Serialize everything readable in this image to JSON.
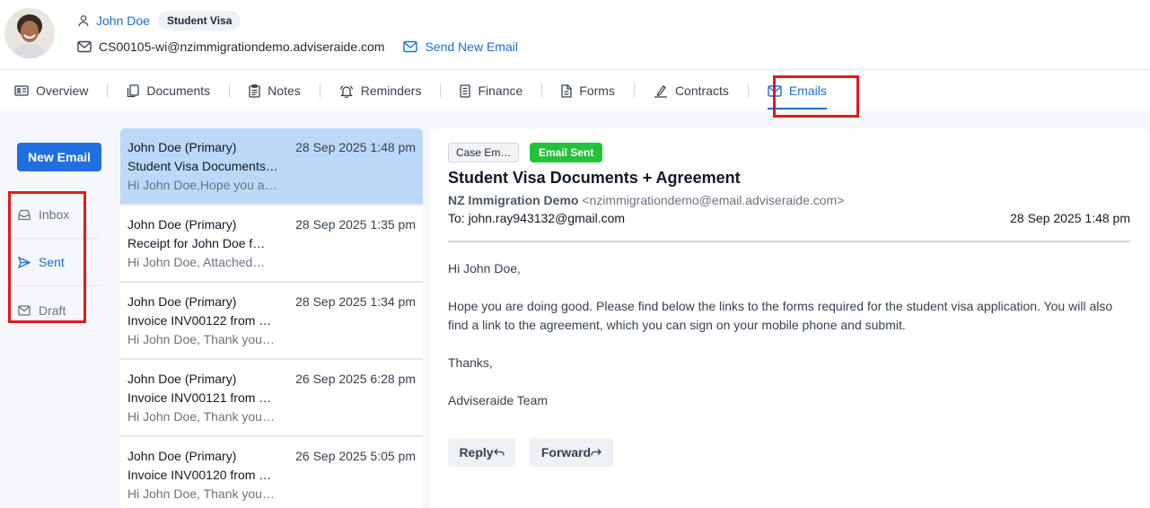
{
  "client": {
    "name": "John Doe",
    "visa_type": "Student Visa",
    "email": "CS00105-wi@nzimmigrationdemo.adviseraide.com",
    "send_new_email": "Send New Email"
  },
  "tabs": [
    {
      "label": "Overview",
      "icon": "id-card-icon"
    },
    {
      "label": "Documents",
      "icon": "documents-icon"
    },
    {
      "label": "Notes",
      "icon": "clipboard-icon"
    },
    {
      "label": "Reminders",
      "icon": "bell-icon"
    },
    {
      "label": "Finance",
      "icon": "ledger-icon"
    },
    {
      "label": "Forms",
      "icon": "file-icon"
    },
    {
      "label": "Contracts",
      "icon": "signature-icon"
    },
    {
      "label": "Emails",
      "icon": "mail-icon",
      "active": true
    }
  ],
  "sidebar": {
    "new_email_label": "New Email",
    "folders": [
      {
        "label": "Inbox",
        "icon": "inbox-icon"
      },
      {
        "label": "Sent",
        "icon": "send-icon",
        "active": true
      },
      {
        "label": "Draft",
        "icon": "draft-icon"
      }
    ]
  },
  "emails": [
    {
      "sender": "John Doe (Primary)",
      "date": "28 Sep 2025 1:48 pm",
      "subject": "Student Visa Documents…",
      "preview": "Hi John Doe,Hope you a…",
      "selected": true
    },
    {
      "sender": "John Doe (Primary)",
      "date": "28 Sep 2025 1:35 pm",
      "subject": "Receipt for John Doe f…",
      "preview": "Hi John Doe, Attached…"
    },
    {
      "sender": "John Doe (Primary)",
      "date": "28 Sep 2025 1:34 pm",
      "subject": "Invoice INV00122 from …",
      "preview": "Hi John Doe, Thank you…"
    },
    {
      "sender": "John Doe (Primary)",
      "date": "26 Sep 2025 6:28 pm",
      "subject": "Invoice INV00121 from …",
      "preview": "Hi John Doe, Thank you…"
    },
    {
      "sender": "John Doe (Primary)",
      "date": "26 Sep 2025 5:05 pm",
      "subject": "Invoice INV00120 from …",
      "preview": "Hi John Doe, Thank you…"
    }
  ],
  "detail": {
    "tag_case": "Case Em…",
    "tag_status": "Email Sent",
    "subject": "Student Visa Documents + Agreement",
    "from_name": "NZ Immigration Demo",
    "from_address": "<nzimmigrationdemo@email.adviseraide.com>",
    "to": "To: john.ray943132@gmail.com",
    "date": "28 Sep 2025 1:48 pm",
    "body": [
      "Hi John Doe,",
      "Hope you are doing good. Please find below the links to the forms required for the student visa application. You will also find a link to the agreement, which you can sign on your mobile phone and submit.",
      "Thanks,",
      "Adviseraide Team"
    ],
    "reply_label": "Reply",
    "forward_label": "Forward"
  },
  "colors": {
    "accent": "#1d6fd1",
    "primary_button": "#1f6fe0",
    "success": "#22c23a",
    "selected_row": "#bcd7f7",
    "highlight_box": "#e0191c"
  }
}
